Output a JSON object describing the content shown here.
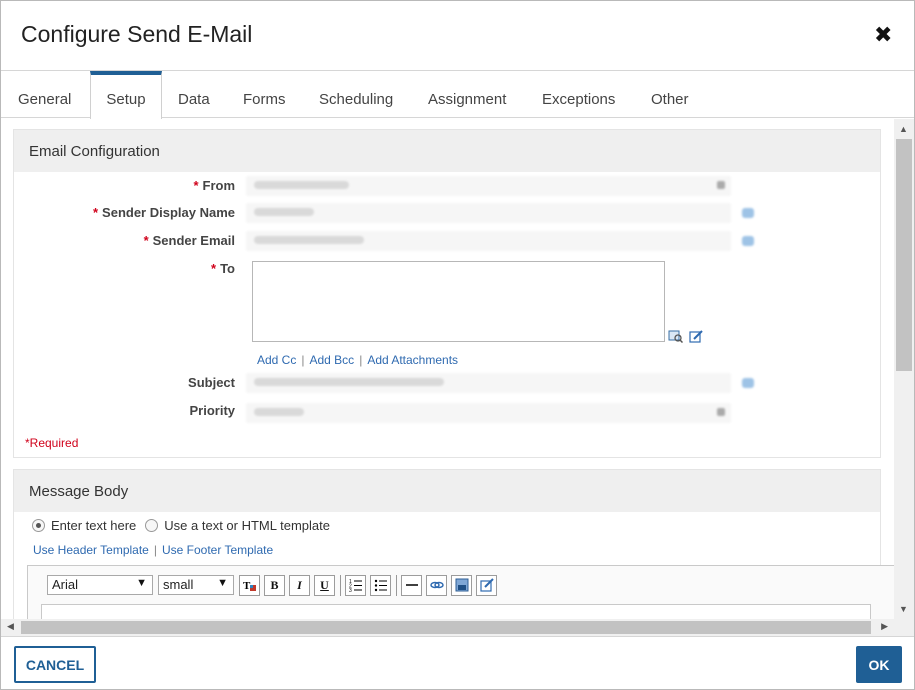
{
  "dialog": {
    "title": "Configure Send E-Mail",
    "close_icon": "close-icon"
  },
  "tabs": [
    {
      "label": "General",
      "active": false
    },
    {
      "label": "Setup",
      "active": true
    },
    {
      "label": "Data",
      "active": false
    },
    {
      "label": "Forms",
      "active": false
    },
    {
      "label": "Scheduling",
      "active": false
    },
    {
      "label": "Assignment",
      "active": false
    },
    {
      "label": "Exceptions",
      "active": false
    },
    {
      "label": "Other",
      "active": false
    }
  ],
  "email_config": {
    "header": "Email Configuration",
    "required_marker": "*",
    "fields": {
      "from": "From",
      "sender_display_name": "Sender Display Name",
      "sender_email": "Sender Email",
      "to": "To",
      "subject": "Subject",
      "priority": "Priority"
    },
    "links": {
      "add_cc": "Add Cc",
      "add_bcc": "Add Bcc",
      "add_attachments": "Add Attachments",
      "separator": "|"
    },
    "required_note": "*Required"
  },
  "message_body": {
    "header": "Message Body",
    "radio_enter_text": "Enter text here",
    "radio_template": "Use a text or HTML template",
    "selected_radio": "enter_text",
    "use_header_template": "Use Header Template",
    "use_footer_template": "Use Footer Template",
    "separator": "|",
    "toolbar": {
      "font_value": "Arial",
      "size_value": "small",
      "dropdown_glyph": "▼",
      "bold": "B",
      "italic": "I",
      "underline": "U"
    }
  },
  "footer": {
    "cancel_label": "CANCEL",
    "ok_label": "OK"
  },
  "colors": {
    "accent": "#1f5f95",
    "required": "#d0021b",
    "link": "#2f6ab0"
  }
}
